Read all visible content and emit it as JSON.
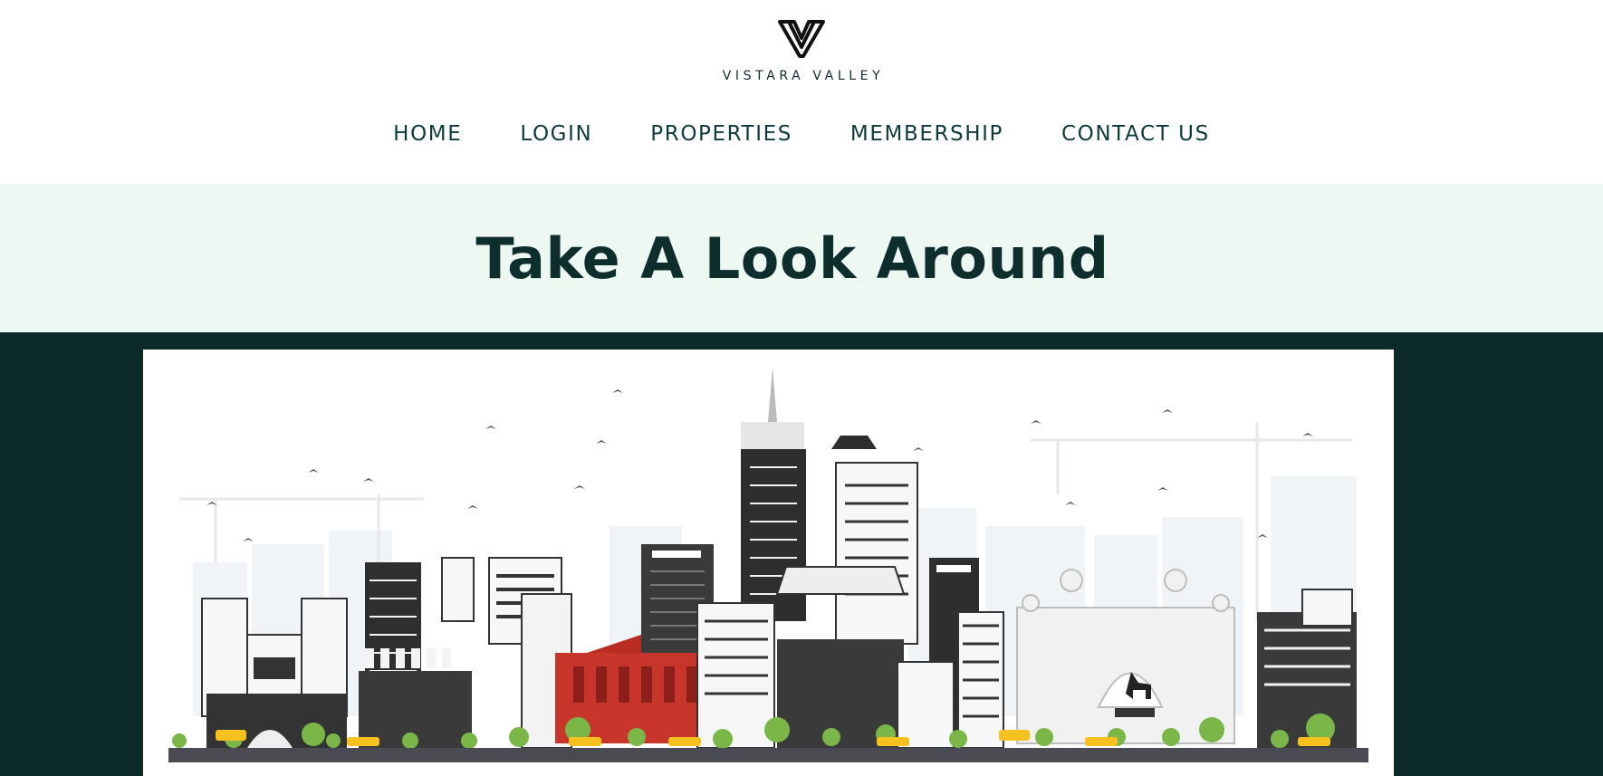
{
  "brand": {
    "name": "VISTARA VALLEY",
    "logo_icon": "v-monogram-icon"
  },
  "nav": {
    "items": [
      {
        "label": "HOME"
      },
      {
        "label": "LOGIN"
      },
      {
        "label": "PROPERTIES"
      },
      {
        "label": "MEMBERSHIP"
      },
      {
        "label": "CONTACT US"
      }
    ]
  },
  "hero": {
    "title": "Take A Look Around"
  },
  "gallery": {
    "image_icon": "city-skyline-illustration"
  },
  "colors": {
    "header_bg": "#ffffff",
    "nav_text": "#0e3b3c",
    "hero_bg": "#eef8f3",
    "hero_text": "#0e2e2e",
    "gallery_bg": "#0c2a2a",
    "accent_red": "#c8362b",
    "taxi_yellow": "#f4c11f",
    "tree_green": "#7ab648"
  }
}
